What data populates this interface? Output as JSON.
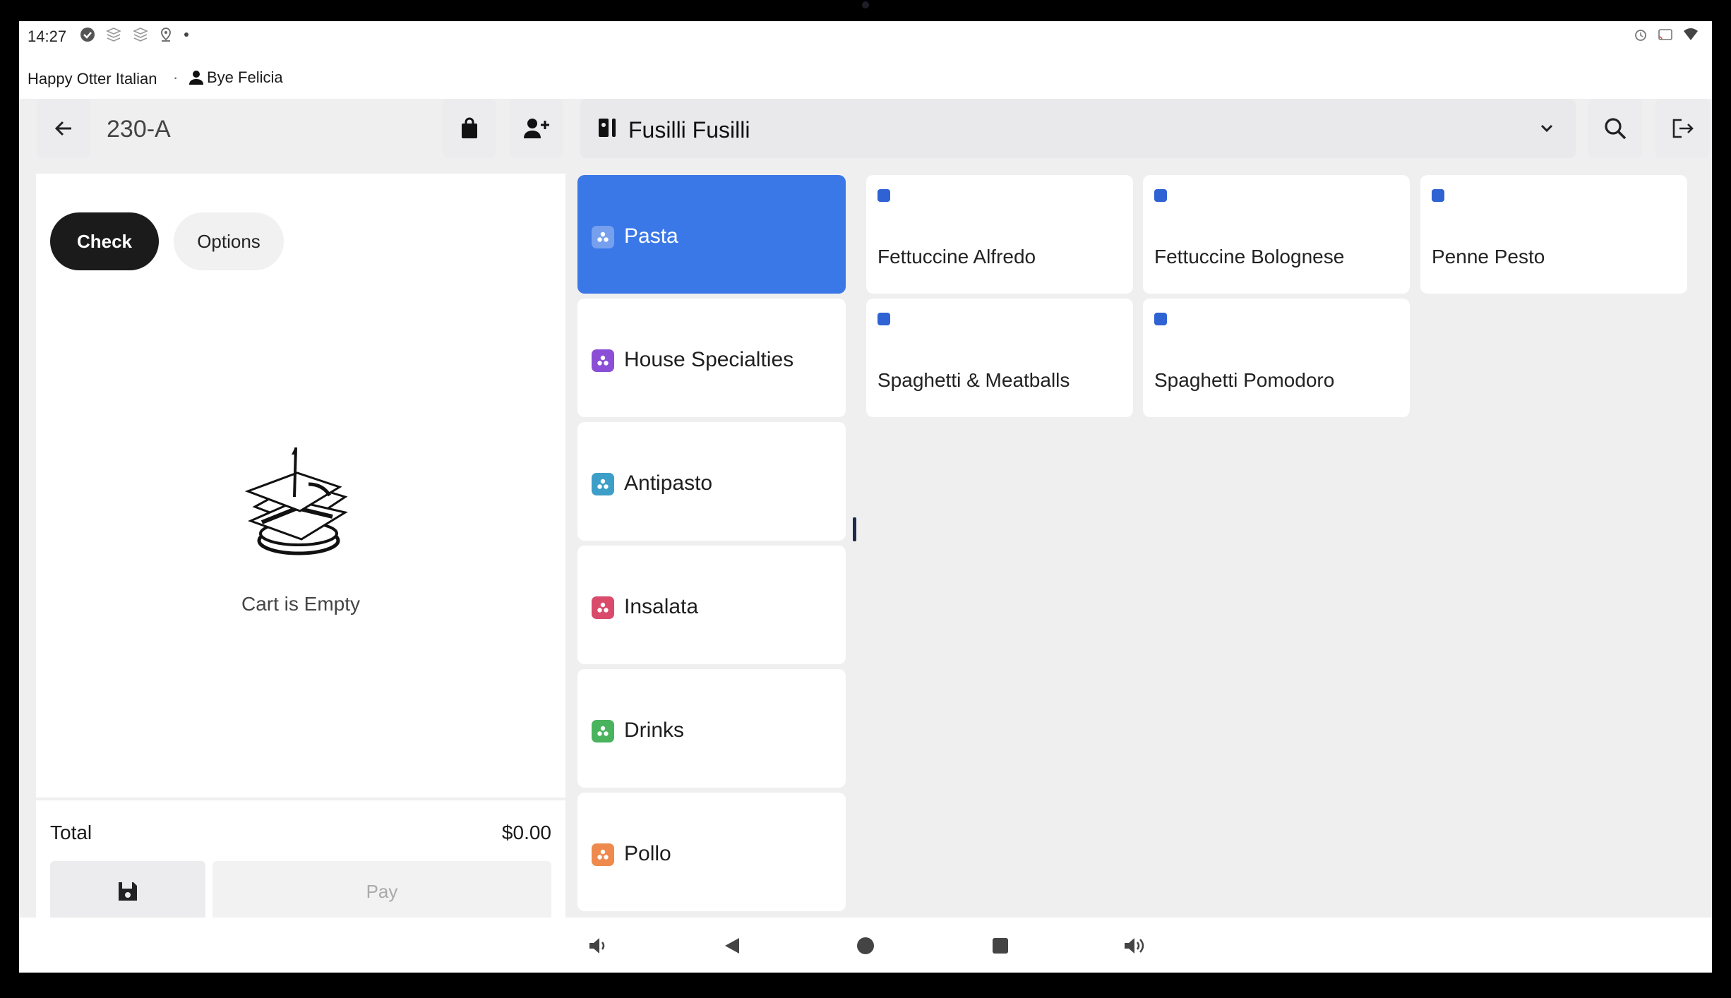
{
  "status_bar": {
    "time": "14:27"
  },
  "info_bar": {
    "location": "Happy Otter Italian",
    "separator": "·",
    "user": "Bye Felicia"
  },
  "toolbar": {
    "order_number": "230-A",
    "menu_name": "Fusilli Fusilli"
  },
  "cart": {
    "tabs": {
      "check": "Check",
      "options": "Options"
    },
    "empty_message": "Cart is Empty",
    "total_label": "Total",
    "total_value": "$0.00",
    "pay_label": "Pay"
  },
  "categories": [
    {
      "label": "Pasta",
      "color": "#3b78e7",
      "active": true
    },
    {
      "label": "House Specialties",
      "color": "#8a4fd6"
    },
    {
      "label": "Antipasto",
      "color": "#3d9fc7"
    },
    {
      "label": "Insalata",
      "color": "#d94a6b"
    },
    {
      "label": "Drinks",
      "color": "#49b35d"
    },
    {
      "label": "Pollo",
      "color": "#ee8a4d"
    }
  ],
  "items": [
    {
      "label": "Fettuccine Alfredo"
    },
    {
      "label": "Fettuccine Bolognese"
    },
    {
      "label": "Penne Pesto"
    },
    {
      "label": "Spaghetti & Meatballs"
    },
    {
      "label": "Spaghetti Pomodoro"
    }
  ],
  "colors": {
    "accent": "#3b78e7",
    "item_marker": "#2f62d3",
    "primary_button": "#1b1b1b"
  }
}
